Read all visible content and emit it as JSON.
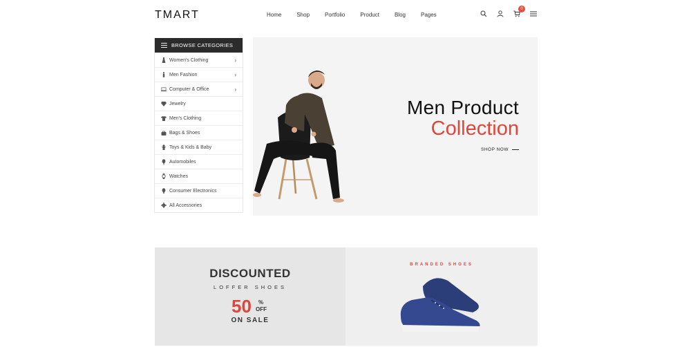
{
  "header": {
    "logo": "TMART",
    "nav": [
      "Home",
      "Shop",
      "Portfolio",
      "Product",
      "Blog",
      "Pages"
    ],
    "cart_count": "0"
  },
  "sidebar": {
    "title": "BROWSE CATEGORIES",
    "items": [
      {
        "label": "Women's Clothing",
        "icon": "dress-icon",
        "has_submenu": true
      },
      {
        "label": "Men Fashion",
        "icon": "man-icon",
        "has_submenu": true
      },
      {
        "label": "Computer & Office",
        "icon": "laptop-icon",
        "has_submenu": true
      },
      {
        "label": "Jewelry",
        "icon": "diamond-icon",
        "has_submenu": false
      },
      {
        "label": "Men's Clothing",
        "icon": "shirt-icon",
        "has_submenu": false
      },
      {
        "label": "Bags & Shoes",
        "icon": "bag-icon",
        "has_submenu": false
      },
      {
        "label": "Toys & Kids & Baby",
        "icon": "toy-icon",
        "has_submenu": false
      },
      {
        "label": "Automobiles",
        "icon": "car-icon",
        "has_submenu": false
      },
      {
        "label": "Watches",
        "icon": "watch-icon",
        "has_submenu": false
      },
      {
        "label": "Consumer Electronics",
        "icon": "phone-icon",
        "has_submenu": false
      },
      {
        "label": "All Accessories",
        "icon": "gear-icon",
        "has_submenu": false
      }
    ]
  },
  "hero": {
    "title_line1": "Men Product",
    "title_line2": "Collection",
    "cta": "SHOP NOW"
  },
  "banner_left": {
    "title": "DISCOUNTED",
    "subtitle": "LOFFER SHOES",
    "percent": "50",
    "percent_symbol": "%",
    "off": "OFF",
    "sale": "ON SALE"
  },
  "banner_right": {
    "label": "BRANDED SHOES"
  },
  "colors": {
    "accent": "#e0453a",
    "dark": "#2b2b2b",
    "hero_bg": "#f4f4f4"
  }
}
